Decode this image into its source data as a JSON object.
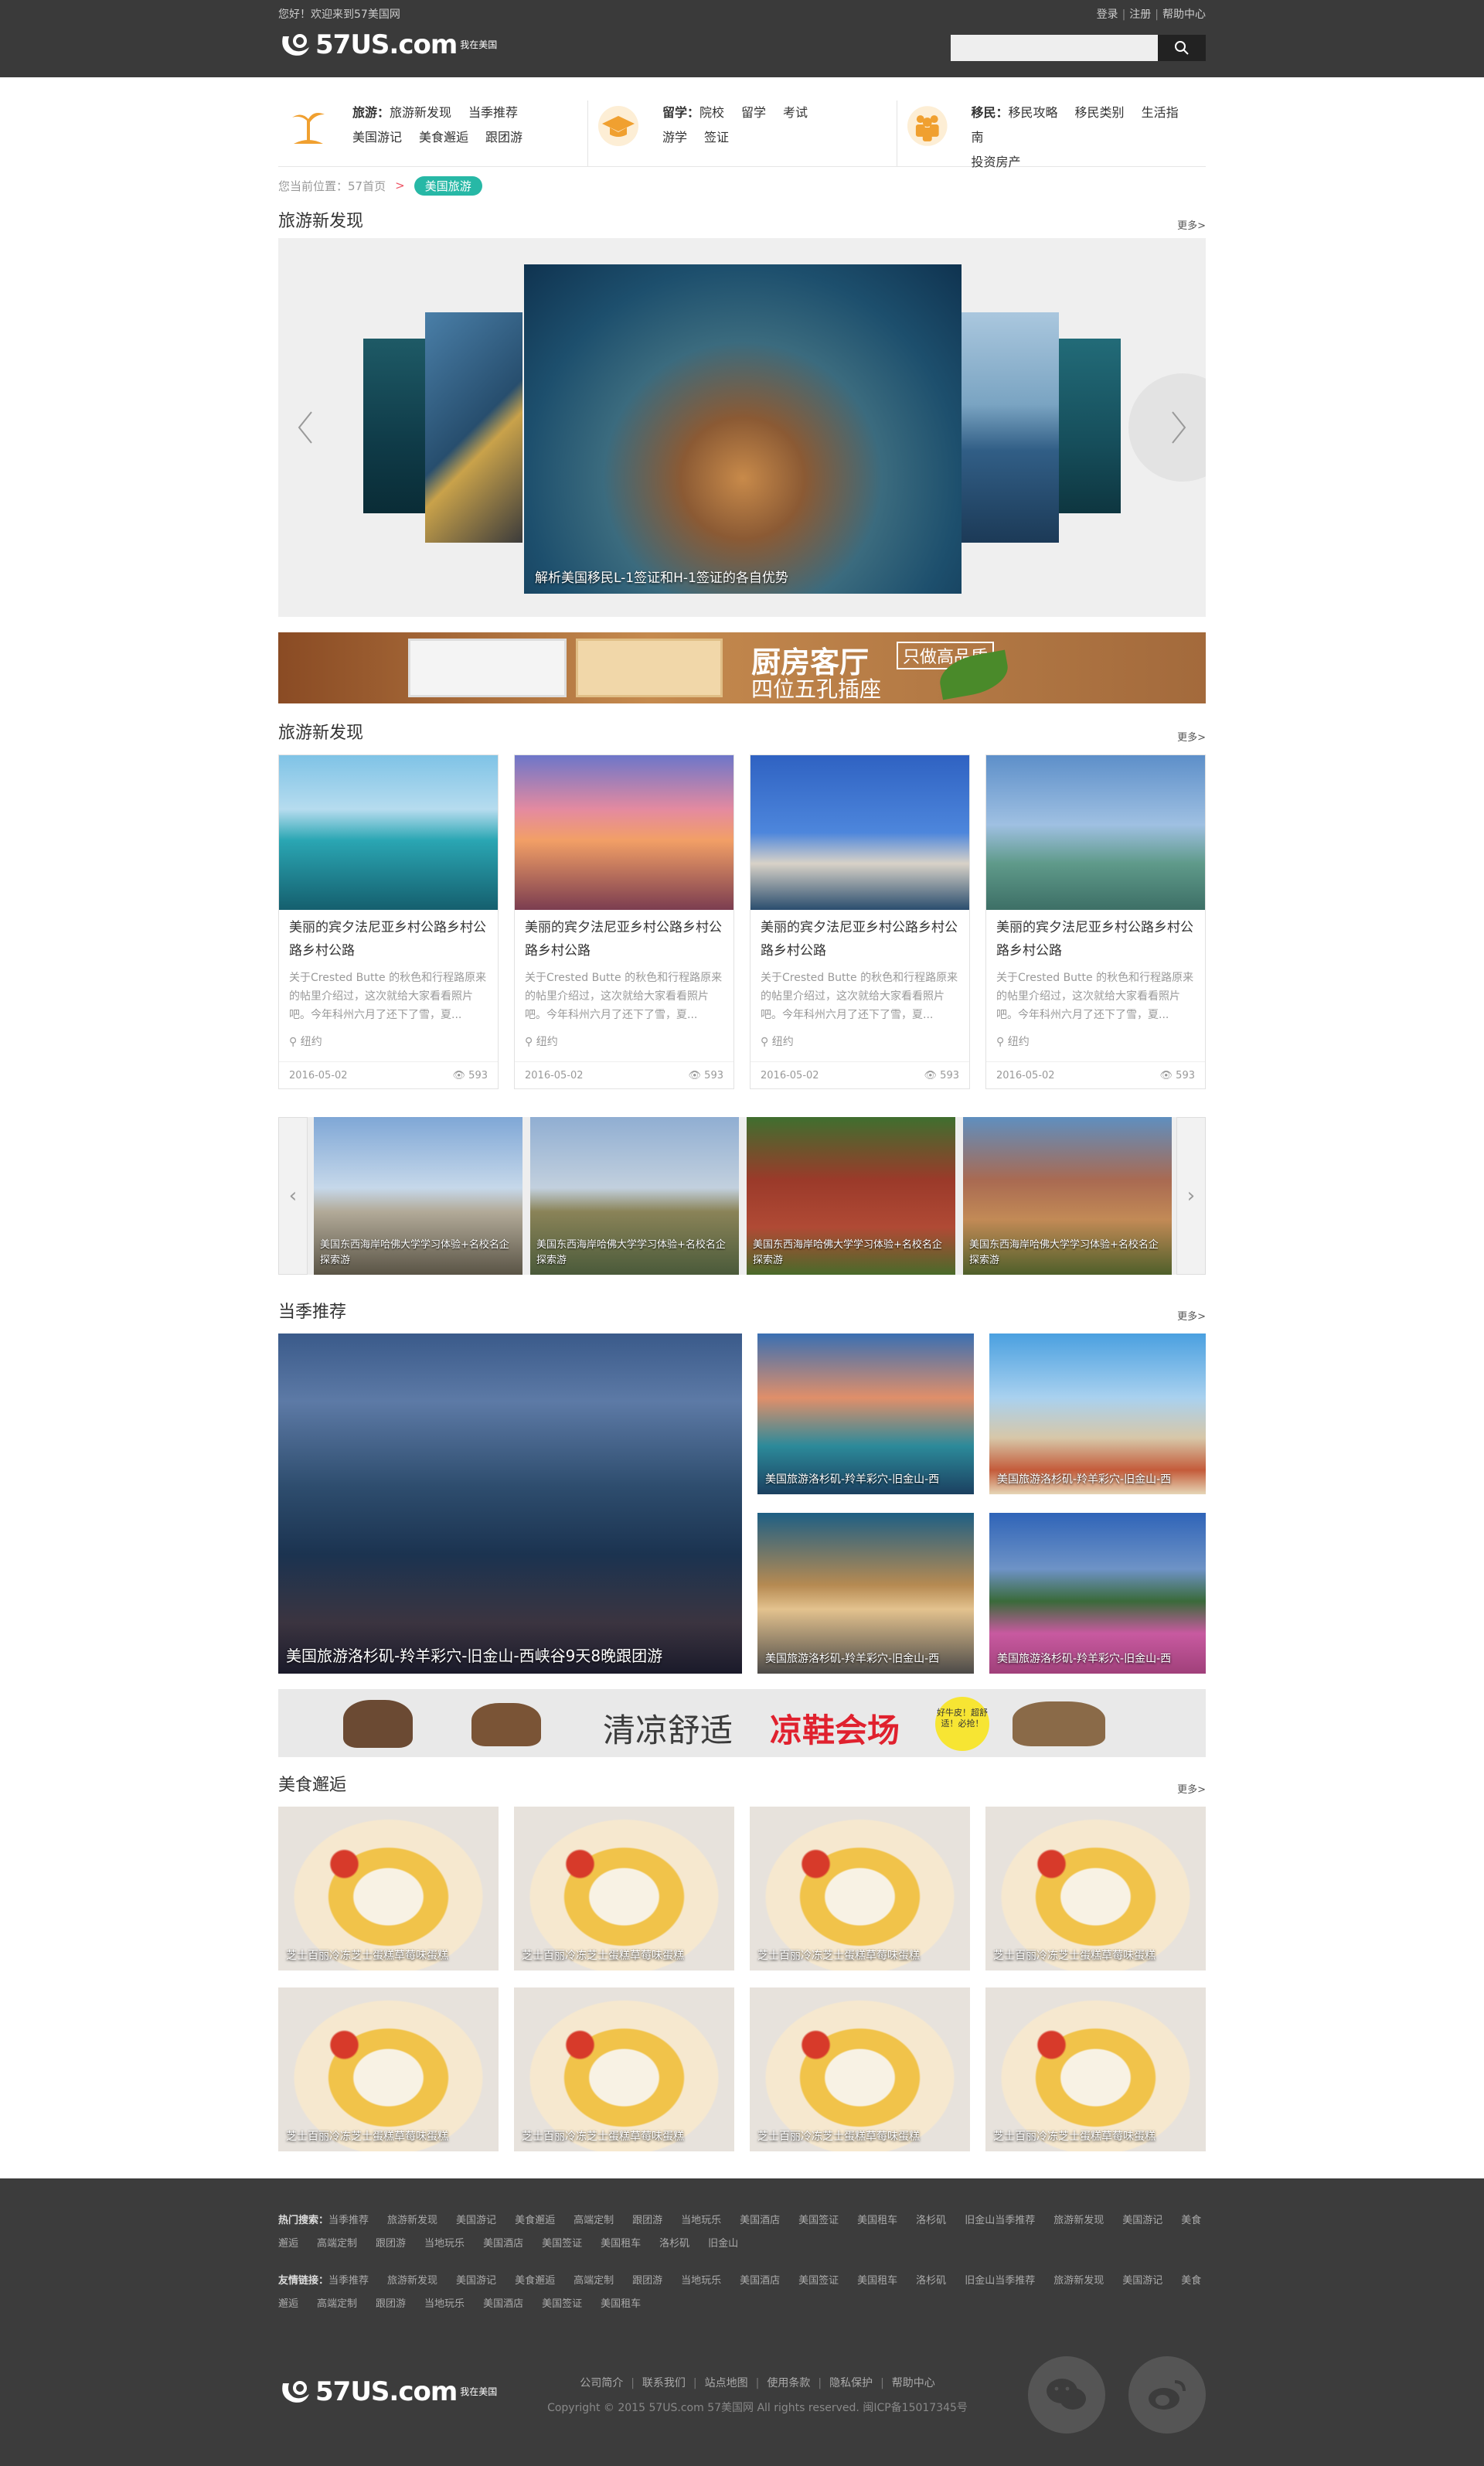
{
  "topbar": {
    "welcome": "您好！欢迎来到57美国网",
    "login": "登录",
    "register": "注册",
    "help": "帮助中心",
    "logo_text": "57US.com",
    "logo_sub": "我在美国",
    "search_placeholder": ""
  },
  "nav": {
    "travel": {
      "title": "旅游：",
      "items": [
        "旅游新发现",
        "当季推荐",
        "美国游记",
        "美食邂逅",
        "跟团游"
      ]
    },
    "study": {
      "title": "留学：",
      "items": [
        "院校",
        "留学",
        "考试",
        "游学",
        "签证"
      ]
    },
    "immigrate": {
      "title": "移民：",
      "items": [
        "移民攻略",
        "移民类别",
        "生活指南",
        "投资房产"
      ]
    }
  },
  "breadcrumb": {
    "label": "您当前位置：",
    "home": "57首页",
    "arrow": ">",
    "current": "美国旅游"
  },
  "sections": {
    "discover1": {
      "title": "旅游新发现",
      "more": "更多>"
    },
    "discover2": {
      "title": "旅游新发现",
      "more": "更多>"
    },
    "season": {
      "title": "当季推荐",
      "more": "更多>"
    },
    "food": {
      "title": "美食邂逅",
      "more": "更多>"
    }
  },
  "carousel": {
    "caption": "解析美国移民L-1签证和H-1签证的各自优势"
  },
  "banner1": {
    "headline": "厨房客厅",
    "tag": "只做高品质",
    "sub": "四位五孔插座"
  },
  "cards": [
    {
      "title": "美丽的宾夕法尼亚乡村公路乡村公路乡村公路",
      "desc": "关于Crested Butte 的秋色和行程路原来的帖里介绍过，这次就给大家看看照片吧。今年科州六月了还下了雪，夏...",
      "location": "纽约",
      "date": "2016-05-02",
      "views": "593"
    },
    {
      "title": "美丽的宾夕法尼亚乡村公路乡村公路乡村公路",
      "desc": "关于Crested Butte 的秋色和行程路原来的帖里介绍过，这次就给大家看看照片吧。今年科州六月了还下了雪，夏...",
      "location": "纽约",
      "date": "2016-05-02",
      "views": "593"
    },
    {
      "title": "美丽的宾夕法尼亚乡村公路乡村公路乡村公路",
      "desc": "关于Crested Butte 的秋色和行程路原来的帖里介绍过，这次就给大家看看照片吧。今年科州六月了还下了雪，夏...",
      "location": "纽约",
      "date": "2016-05-02",
      "views": "593"
    },
    {
      "title": "美丽的宾夕法尼亚乡村公路乡村公路乡村公路",
      "desc": "关于Crested Butte 的秋色和行程路原来的帖里介绍过，这次就给大家看看照片吧。今年科州六月了还下了雪，夏...",
      "location": "纽约",
      "date": "2016-05-02",
      "views": "593"
    }
  ],
  "strip": [
    "美国东西海岸哈佛大学学习体验+名校名企探索游",
    "美国东西海岸哈佛大学学习体验+名校名企探索游",
    "美国东西海岸哈佛大学学习体验+名校名企探索游",
    "美国东西海岸哈佛大学学习体验+名校名企探索游"
  ],
  "season": {
    "big": "美国旅游洛杉矶-羚羊彩穴-旧金山-西峡谷9天8晚跟团游",
    "small": [
      "美国旅游洛杉矶-羚羊彩穴-旧金山-西",
      "美国旅游洛杉矶-羚羊彩穴-旧金山-西",
      "美国旅游洛杉矶-羚羊彩穴-旧金山-西",
      "美国旅游洛杉矶-羚羊彩穴-旧金山-西"
    ]
  },
  "banner2": {
    "text1": "清凉舒适",
    "text2": "凉鞋会场",
    "badge": "好牛皮！超舒适！必抢！"
  },
  "food": [
    "芝士百丽冷冻芝士蛋糕草莓味蛋糕",
    "芝士百丽冷冻芝士蛋糕草莓味蛋糕",
    "芝士百丽冷冻芝士蛋糕草莓味蛋糕",
    "芝士百丽冷冻芝士蛋糕草莓味蛋糕",
    "芝士百丽冷冻芝士蛋糕草莓味蛋糕",
    "芝士百丽冷冻芝士蛋糕草莓味蛋糕",
    "芝士百丽冷冻芝士蛋糕草莓味蛋糕",
    "芝士百丽冷冻芝士蛋糕草莓味蛋糕"
  ],
  "footer": {
    "hot_label": "热门搜索：",
    "hot": [
      "当季推荐",
      "旅游新发现",
      "美国游记",
      "美食邂逅",
      "高端定制",
      "跟团游",
      "当地玩乐",
      "美国酒店",
      "美国签证",
      "美国租车",
      "洛杉矶",
      "旧金山当季推荐",
      "旅游新发现",
      "美国游记",
      "美食邂逅",
      "高端定制",
      "跟团游",
      "当地玩乐",
      "美国酒店",
      "美国签证",
      "美国租车",
      "洛杉矶",
      "旧金山"
    ],
    "friend_label": "友情链接：",
    "friend": [
      "当季推荐",
      "旅游新发现",
      "美国游记",
      "美食邂逅",
      "高端定制",
      "跟团游",
      "当地玩乐",
      "美国酒店",
      "美国签证",
      "美国租车",
      "洛杉矶",
      "旧金山当季推荐",
      "旅游新发现",
      "美国游记",
      "美食邂逅",
      "高端定制",
      "跟团游",
      "当地玩乐",
      "美国酒店",
      "美国签证",
      "美国租车"
    ],
    "nav": [
      "公司简介",
      "联系我们",
      "站点地图",
      "使用条款",
      "隐私保护",
      "帮助中心"
    ],
    "copyright": "Copyright © 2015 57US.com 57美国网 All rights reserved. 闽ICP备15017345号",
    "logo_text": "57US.com",
    "logo_sub": "我在美国"
  }
}
